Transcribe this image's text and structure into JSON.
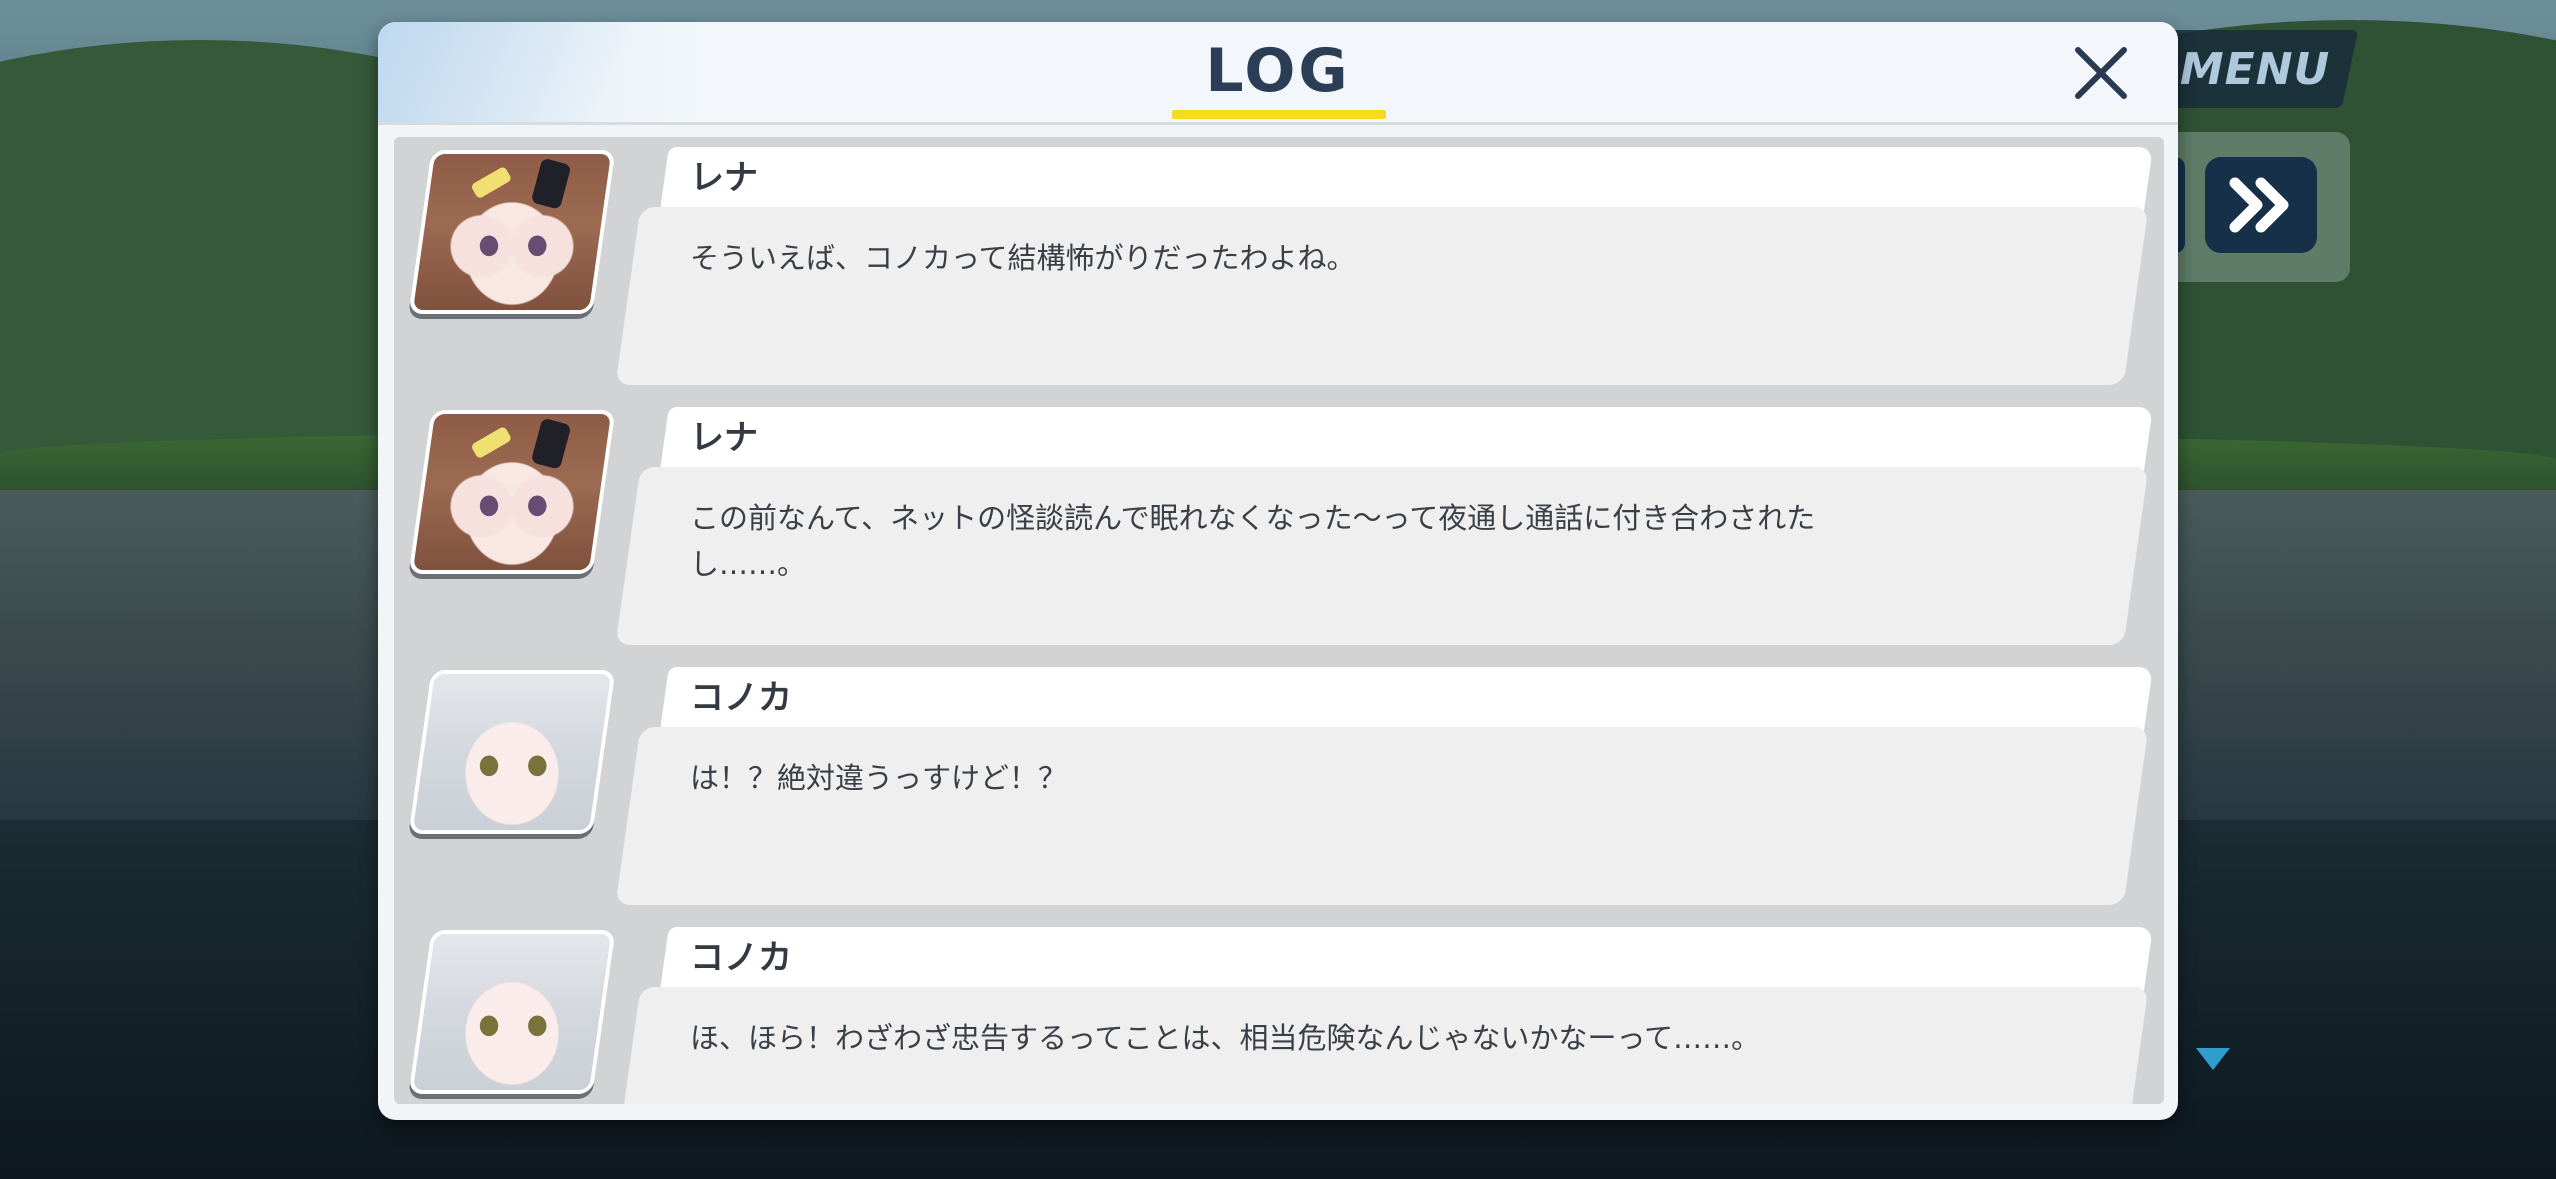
{
  "hud": {
    "menu_label": "MENU",
    "fast_forward_icon": "double-chevron-right-icon",
    "scroll_indicator_icon": "triangle-down-icon"
  },
  "log": {
    "title": "LOG",
    "close_icon": "close-x-icon",
    "entries": [
      {
        "speaker": "レナ",
        "avatar": "rena-portrait",
        "text": "そういえば、コノカって結構怖がりだったわよね。"
      },
      {
        "speaker": "レナ",
        "avatar": "rena-portrait",
        "text": "この前なんて、ネットの怪談読んで眠れなくなった～って夜通し通話に付き合わされた\nし……。"
      },
      {
        "speaker": "コノカ",
        "avatar": "konoka-portrait",
        "text": "は！？絶対違うっすけど！？"
      },
      {
        "speaker": "コノカ",
        "avatar": "konoka-portrait",
        "text": "ほ、ほら！わざわざ忠告するってことは、相当危険なんじゃないかなーって……。"
      }
    ]
  },
  "colors": {
    "title_text": "#2c3e55",
    "title_underline": "#f5dc1f",
    "fast_forward_bg": "#17304a",
    "scroll_arrow": "#2f9ecf"
  }
}
